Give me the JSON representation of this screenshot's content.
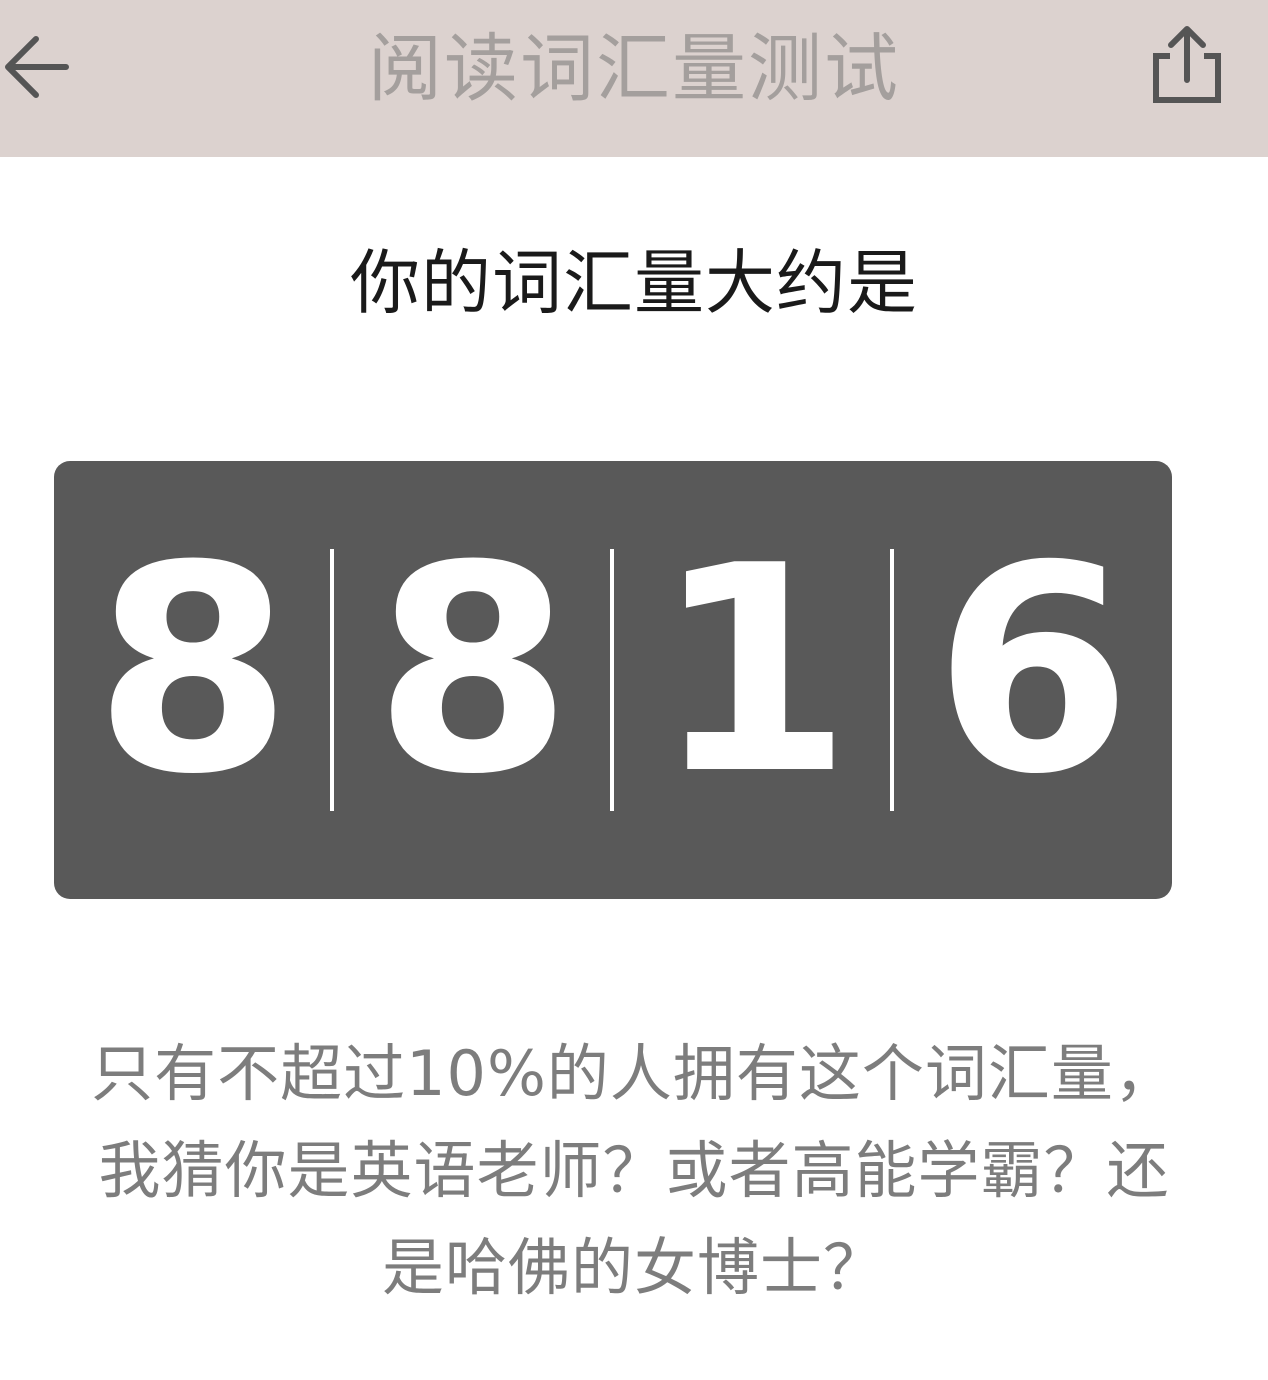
{
  "header": {
    "title": "阅读词汇量测试",
    "back_icon": "arrow-left-icon",
    "share_icon": "share-icon",
    "background_color": "#dcd2cf",
    "title_color": "#a49f9d"
  },
  "result": {
    "subtitle": "你的词汇量大约是",
    "digits": [
      "8",
      "8",
      "1",
      "6"
    ],
    "counter_color": "#595959",
    "digit_color": "#ffffff"
  },
  "message": {
    "text": "只有不超过10%的人拥有这个词汇量，我猜你是英语老师？或者高能学霸？还是哈佛的女博士？",
    "color": "#7d7d7d"
  }
}
